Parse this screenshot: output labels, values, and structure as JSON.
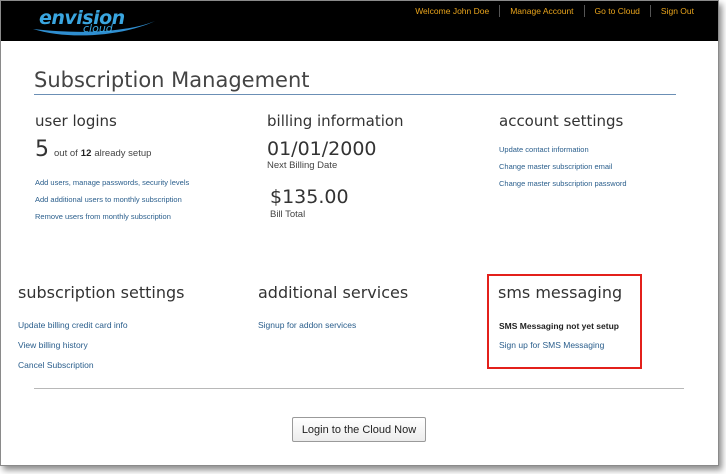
{
  "header": {
    "logo_main": "envision",
    "logo_sub": "cloud",
    "welcome": "Welcome John Doe",
    "nav": [
      "Manage Account",
      "Go to Cloud",
      "Sign Out"
    ]
  },
  "page_title": "Subscription Management",
  "user_logins": {
    "heading": "user logins",
    "count": "5",
    "out_of": "out of",
    "total": "12",
    "suffix": "already setup",
    "links": [
      "Add users, manage passwords, security levels",
      "Add additional users to monthly subscription",
      "Remove users from monthly subscription"
    ]
  },
  "billing": {
    "heading": "billing information",
    "next_date": "01/01/2000",
    "next_date_caption": "Next Billing Date",
    "total": "$135.00",
    "total_caption": "Bill Total"
  },
  "account_settings": {
    "heading": "account settings",
    "links": [
      "Update contact information",
      "Change master subscription email",
      "Change master subscription password"
    ]
  },
  "subscription_settings": {
    "heading": "subscription settings",
    "links": [
      "Update billing credit card info",
      "View billing history",
      "Cancel Subscription"
    ]
  },
  "additional_services": {
    "heading": "additional services",
    "links": [
      "Signup for addon services"
    ]
  },
  "sms": {
    "heading": "sms messaging",
    "status": "SMS Messaging not yet setup",
    "link": "Sign up for SMS Messaging"
  },
  "cloud_button": "Login to the Cloud Now",
  "colors": {
    "header_bg": "#000000",
    "nav_text": "#e8a31b",
    "logo": "#3aa6e0",
    "link": "#2a5e8c",
    "highlight_box": "#e3201b"
  }
}
